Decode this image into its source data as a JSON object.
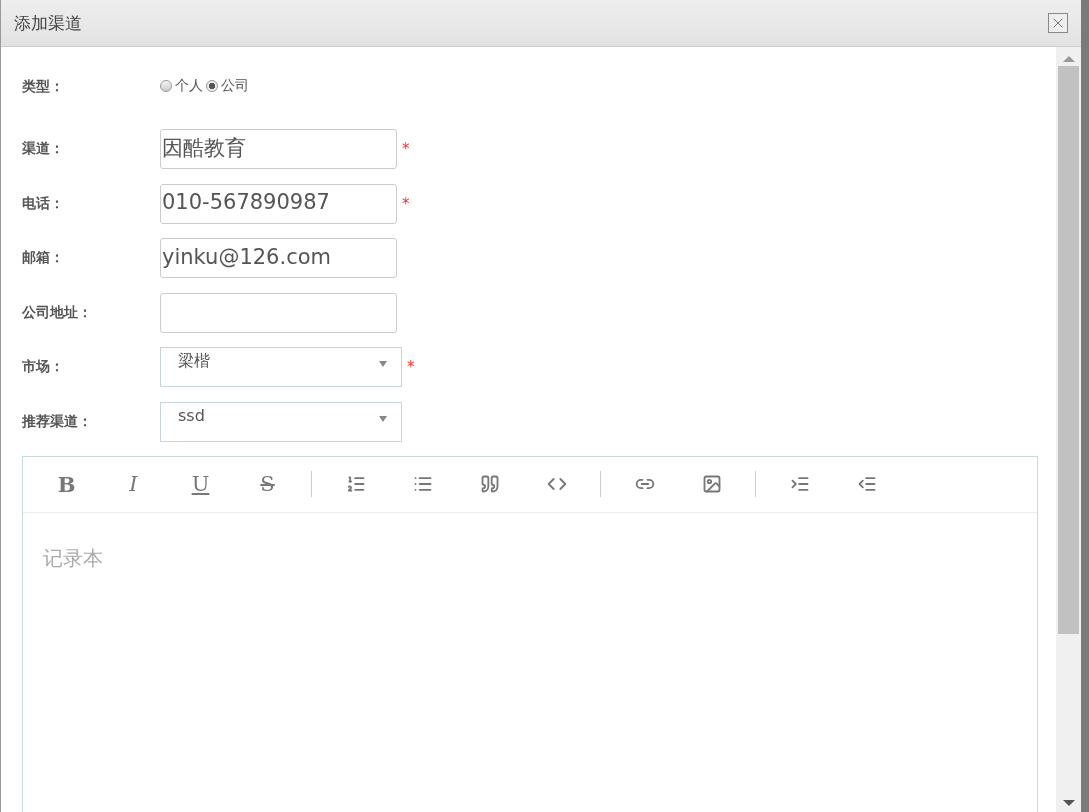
{
  "window": {
    "title": "添加渠道"
  },
  "form": {
    "type": {
      "label": "类型：",
      "options": [
        {
          "label": "个人",
          "selected": false
        },
        {
          "label": "公司",
          "selected": true
        }
      ]
    },
    "fields": [
      {
        "kind": "input",
        "label": "渠道：",
        "value": "因酷教育",
        "required_mark": "*"
      },
      {
        "kind": "input",
        "label": "电话：",
        "value": "010-567890987",
        "required_mark": "*"
      },
      {
        "kind": "input",
        "label": "邮箱：",
        "value": "yinku@126.com"
      },
      {
        "kind": "input",
        "label": "公司地址："
      },
      {
        "kind": "select",
        "label": "市场：",
        "value": "梁楷",
        "required_mark": "*"
      },
      {
        "kind": "select",
        "label": "推荐渠道：",
        "value": "ssd"
      }
    ]
  },
  "editor": {
    "toolbar": [
      [
        {
          "kind": "bold",
          "label": "B"
        },
        {
          "kind": "italic",
          "label": "I"
        },
        {
          "kind": "underline",
          "label": "U"
        },
        {
          "kind": "strike",
          "label": "S"
        }
      ],
      [
        {
          "kind": "ordered-list"
        },
        {
          "kind": "bullet-list"
        },
        {
          "kind": "quote"
        },
        {
          "kind": "code"
        }
      ],
      [
        {
          "kind": "link"
        },
        {
          "kind": "image"
        }
      ],
      [
        {
          "kind": "indent"
        },
        {
          "kind": "outdent"
        }
      ]
    ],
    "placeholder": "记录本"
  }
}
